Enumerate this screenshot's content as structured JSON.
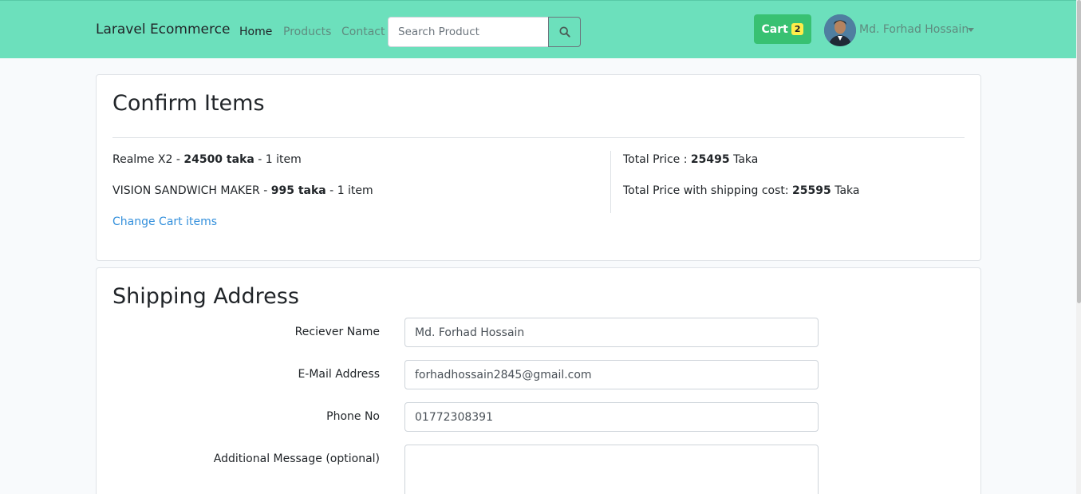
{
  "navbar": {
    "brand": "Laravel Ecommerce",
    "links": [
      "Home",
      "Products",
      "Contact"
    ],
    "search_placeholder": "Search Product",
    "cart_label": "Cart",
    "cart_count": "2",
    "user_name": "Md. Forhad Hossain"
  },
  "confirm": {
    "title": "Confirm Items",
    "items": [
      {
        "name": "Realme X2",
        "price": "24500 taka",
        "qty": "1 item"
      },
      {
        "name": "VISION SANDWICH MAKER",
        "price": "995 taka",
        "qty": "1 item"
      }
    ],
    "change_link": "Change Cart items",
    "total_label": "Total Price :",
    "total_value": "25495",
    "total_unit": "Taka",
    "shipping_label": "Total Price with shipping cost:",
    "shipping_value": "25595",
    "shipping_unit": "Taka"
  },
  "shipping": {
    "title": "Shipping Address",
    "fields": [
      {
        "label": "Reciever Name",
        "value": "Md. Forhad Hossain"
      },
      {
        "label": "E-Mail Address",
        "value": "forhadhossain2845@gmail.com"
      },
      {
        "label": "Phone No",
        "value": "01772308391"
      },
      {
        "label": "Additional Message (optional)",
        "value": ""
      }
    ]
  },
  "colors": {
    "navbar_bg": "#6ce0bc",
    "cart_bg": "#38c172",
    "badge_bg": "#ffed4a",
    "link": "#3490dc"
  }
}
